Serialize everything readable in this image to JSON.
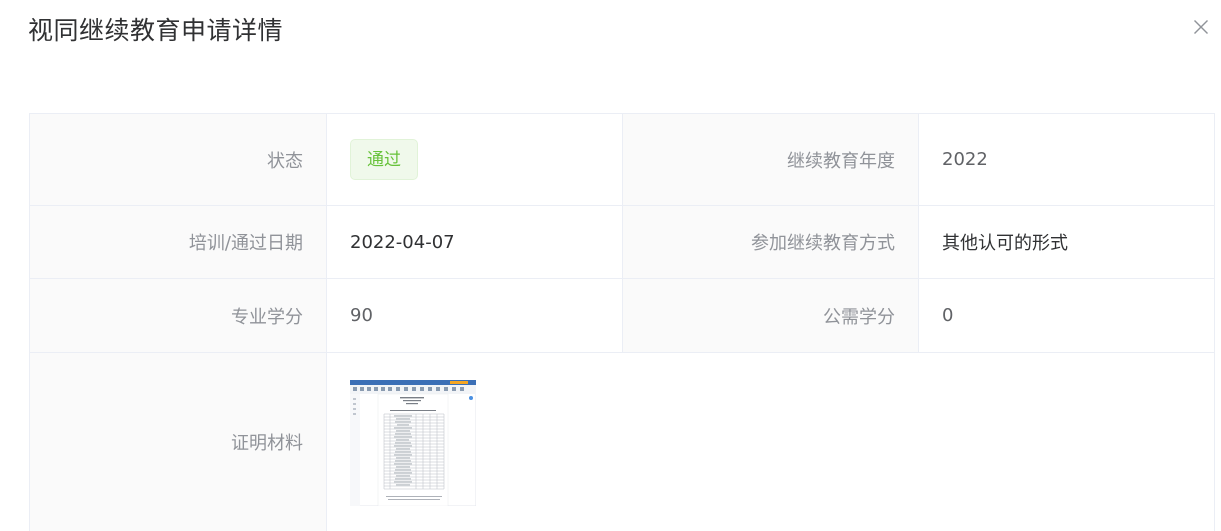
{
  "dialog": {
    "title": "视同继续教育申请详情",
    "close_icon": "close-icon"
  },
  "detail": {
    "status_label": "状态",
    "status_value": "通过",
    "year_label": "继续教育年度",
    "year_value": "2022",
    "date_label": "培训/通过日期",
    "date_value": "2022-04-07",
    "method_label": "参加继续教育方式",
    "method_value": "其他认可的形式",
    "professional_credit_label": "专业学分",
    "professional_credit_value": "90",
    "public_credit_label": "公需学分",
    "public_credit_value": "0",
    "proof_label": "证明材料",
    "proof_icon": "document-thumbnail-icon"
  },
  "colors": {
    "status_text": "#67c23a",
    "status_bg": "#f0f9eb",
    "label_text": "#909399",
    "value_text": "#606266",
    "border": "#ebeef5"
  }
}
